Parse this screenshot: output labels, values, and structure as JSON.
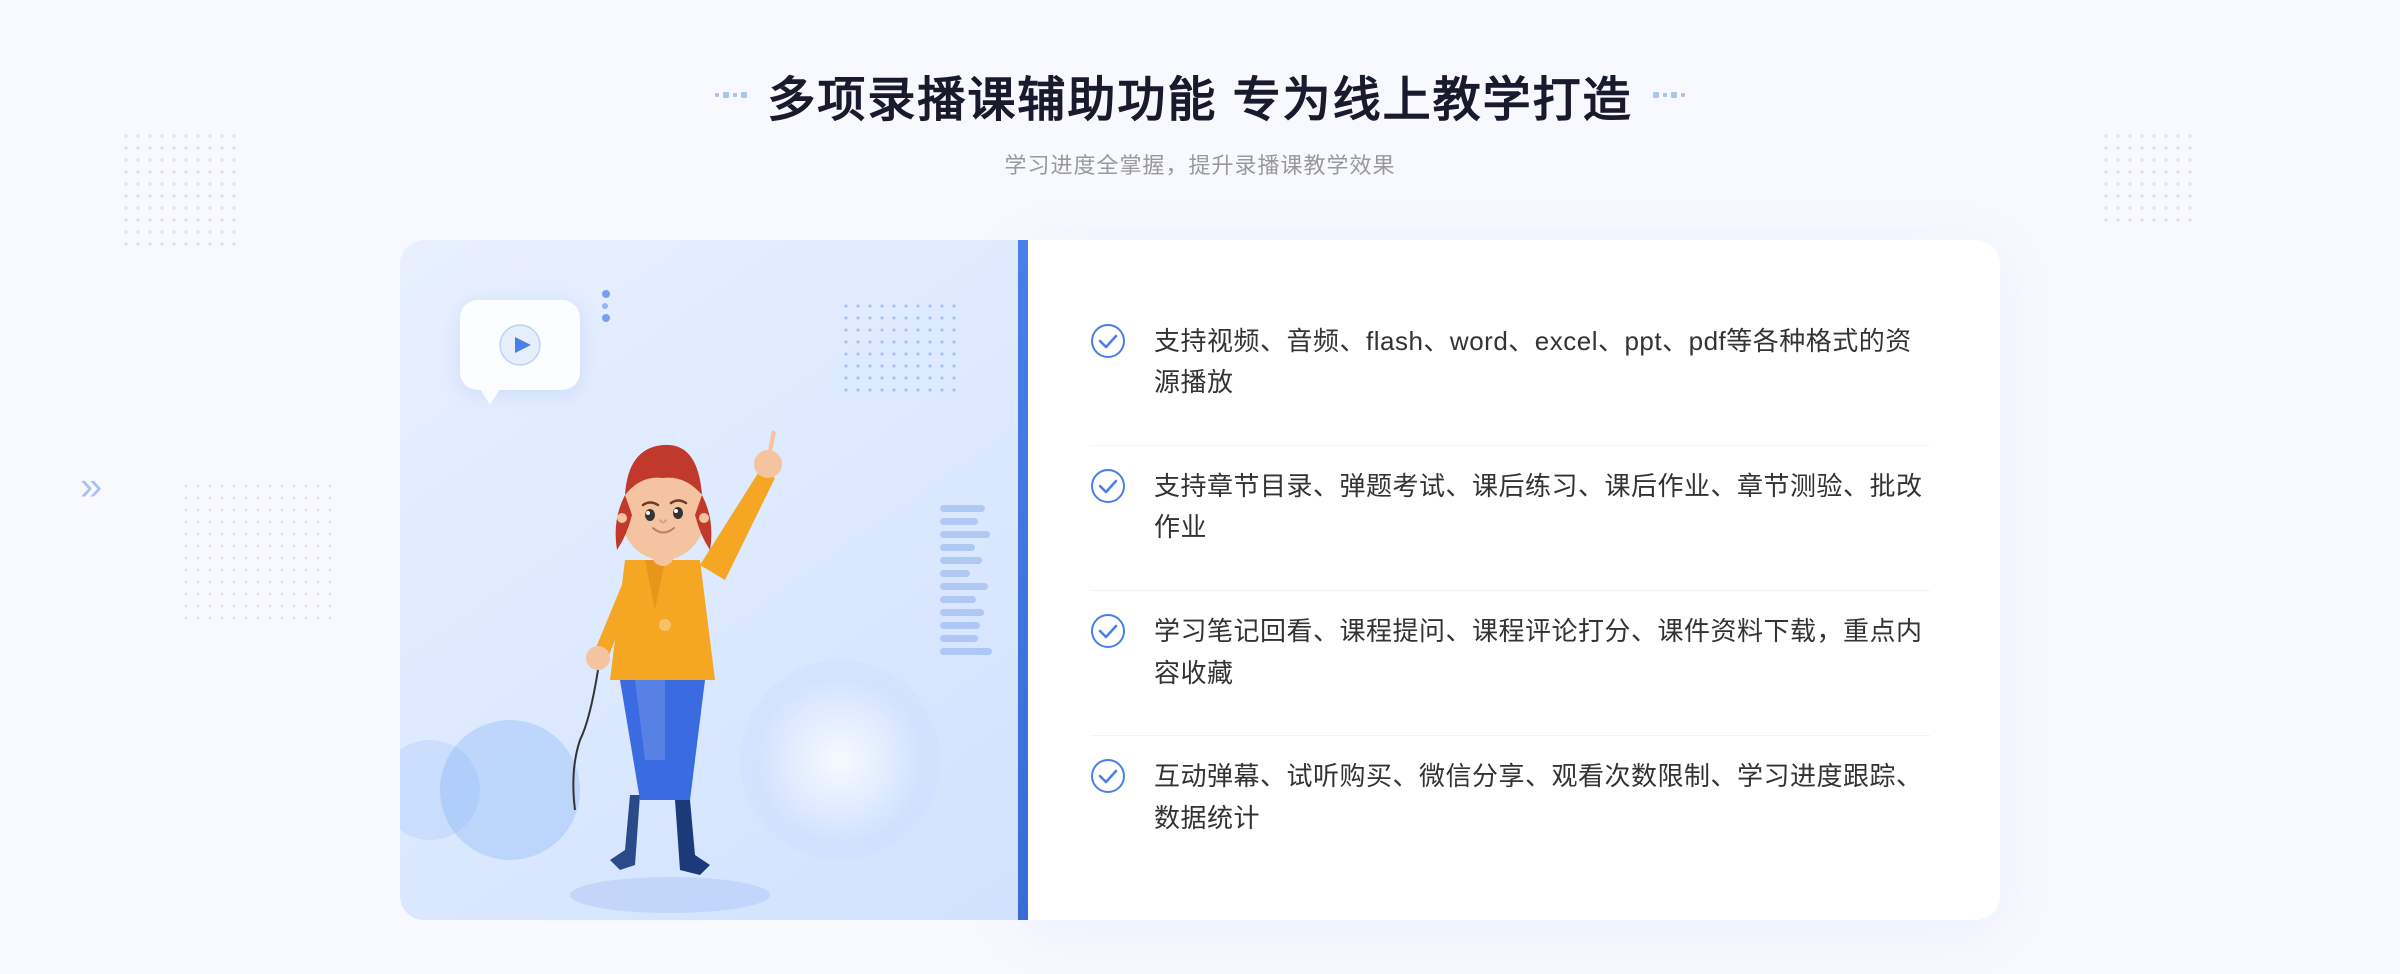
{
  "header": {
    "title": "多项录播课辅助功能 专为线上教学打造",
    "subtitle": "学习进度全掌握，提升录播课教学效果"
  },
  "features": [
    {
      "id": "feature-1",
      "text": "支持视频、音频、flash、word、excel、ppt、pdf等各种格式的资源播放"
    },
    {
      "id": "feature-2",
      "text": "支持章节目录、弹题考试、课后练习、课后作业、章节测验、批改作业"
    },
    {
      "id": "feature-3",
      "text": "学习笔记回看、课程提问、课程评论打分、课件资料下载，重点内容收藏"
    },
    {
      "id": "feature-4",
      "text": "互动弹幕、试听购买、微信分享、观看次数限制、学习进度跟踪、数据统计"
    }
  ],
  "colors": {
    "primary": "#4a7ee8",
    "accent": "#3a6bd5",
    "text_dark": "#1a1a2e",
    "text_gray": "#999999",
    "text_body": "#333333",
    "bg_light": "#f8f9ff",
    "check_color": "#4a7ee8"
  },
  "decorators": {
    "left_arrow": "»",
    "right_dots": "⁚ ⁚"
  }
}
